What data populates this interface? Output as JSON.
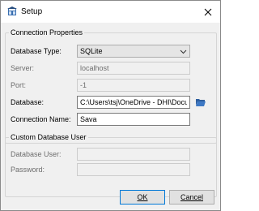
{
  "window": {
    "title": "Setup",
    "icon": "database-app-icon",
    "close_icon": "close-icon"
  },
  "connection": {
    "group_label": "Connection Properties",
    "database_type_label": "Database Type:",
    "database_type_value": "SQLite",
    "server_label": "Server:",
    "server_value": "localhost",
    "port_label": "Port:",
    "port_value": "-1",
    "database_label": "Database:",
    "database_value": "C:\\Users\\tsj\\OneDrive - DHI\\Docum",
    "browse_icon": "folder-open-icon",
    "connection_name_label": "Connection Name:",
    "connection_name_value": "Sava"
  },
  "custom_user": {
    "group_label": "Custom Database User",
    "user_label": "Database User:",
    "user_value": "",
    "password_label": "Password:",
    "password_value": ""
  },
  "buttons": {
    "ok_label": "OK",
    "cancel_label": "Cancel"
  },
  "colors": {
    "window_bg": "#f0f0f0",
    "accent": "#0078d7"
  }
}
